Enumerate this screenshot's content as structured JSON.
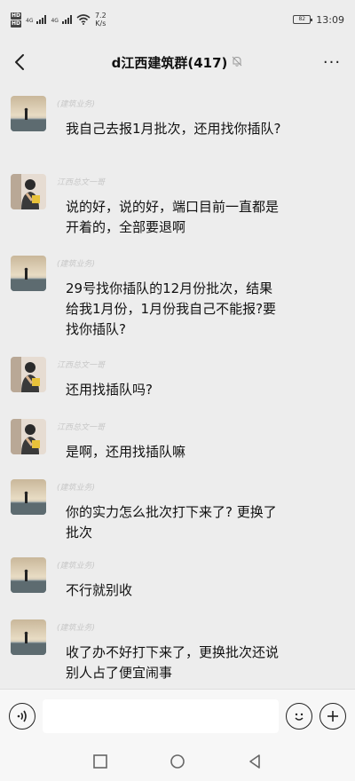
{
  "status_bar": {
    "hd1": "HD",
    "hd2": "HD",
    "net1": "4G",
    "net2": "4G",
    "speed_value": "7.2",
    "speed_unit": "K/s",
    "battery": "82",
    "time": "13:09"
  },
  "nav": {
    "title": "d江西建筑群(417)",
    "more_label": "···",
    "icons": {
      "back": "chevron-left-icon",
      "mute": "bell-off-icon",
      "more": "more-icon"
    }
  },
  "messages": [
    {
      "sender": "(建筑业务)",
      "avatar": "beach",
      "text": "我自己去报1月批次，还用找你插队?"
    },
    {
      "sender": "江西总文一哥",
      "avatar": "person",
      "text": "说的好，说的好，端口目前一直都是开着的，全部要退啊"
    },
    {
      "sender": "(建筑业务)",
      "avatar": "beach",
      "text": "29号找你插队的12月份批次，结果给我1月份，1月份我自己不能报?要找你插队?"
    },
    {
      "sender": "江西总文一哥",
      "avatar": "person",
      "text": "还用找插队吗?"
    },
    {
      "sender": "江西总文一哥",
      "avatar": "person",
      "text": "是啊，还用找插队嘛"
    },
    {
      "sender": "(建筑业务)",
      "avatar": "beach",
      "text": "你的实力怎么批次打下来了? 更换了批次"
    },
    {
      "sender": "(建筑业务)",
      "avatar": "beach",
      "text": "不行就别收"
    },
    {
      "sender": "(建筑业务)",
      "avatar": "beach",
      "text": "收了办不好打下来了，更换批次还说别人占了便宜闹事"
    }
  ],
  "input_bar": {
    "value": "",
    "placeholder": "",
    "icons": {
      "voice": "voice-icon",
      "emoji": "emoji-icon",
      "add": "plus-icon"
    }
  },
  "system_nav": {
    "icons": {
      "recent": "square-icon",
      "home": "circle-icon",
      "back": "triangle-back-icon"
    }
  },
  "colors": {
    "background": "#ededed",
    "input_background": "#f7f7f7",
    "sender_name": "#c8c8c8"
  }
}
